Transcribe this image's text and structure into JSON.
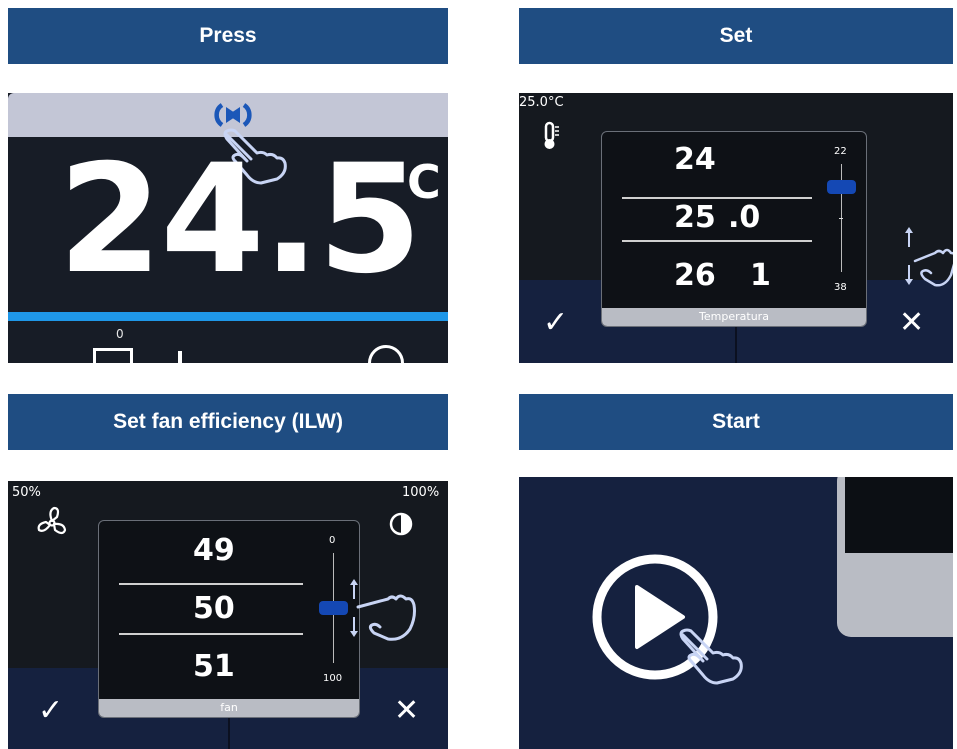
{
  "headers": {
    "press": "Press",
    "set": "Set",
    "fan": "Set fan efficiency (ILW)",
    "start": "Start"
  },
  "press_panel": {
    "temperature": "24.5",
    "unit": "°C",
    "zero_label": "0"
  },
  "set_panel": {
    "current_temp": "25.0°C",
    "picker": {
      "rows": [
        {
          "int": "24",
          "dec": ""
        },
        {
          "int": "25",
          "dec": ".0"
        },
        {
          "int": "26",
          "dec": "1"
        }
      ],
      "scale_top": "22",
      "scale_bottom": "38",
      "label": "Temperatura"
    },
    "confirm": "✓",
    "cancel": "✕"
  },
  "fan_panel": {
    "left_value": "50%",
    "right_value": "100%",
    "picker": {
      "rows": [
        "49",
        "50",
        "51"
      ],
      "scale_top": "0",
      "scale_bottom": "100",
      "label": "fan"
    },
    "confirm": "✓",
    "cancel": "✕"
  },
  "start_panel": {
    "icon": "play-icon"
  },
  "colors": {
    "header_bg": "#1f4d82",
    "panel_bg": "#161b26",
    "bottom_bar": "#15213f",
    "accent_blue": "#1f97e8",
    "slider_blue": "#1448b4"
  }
}
